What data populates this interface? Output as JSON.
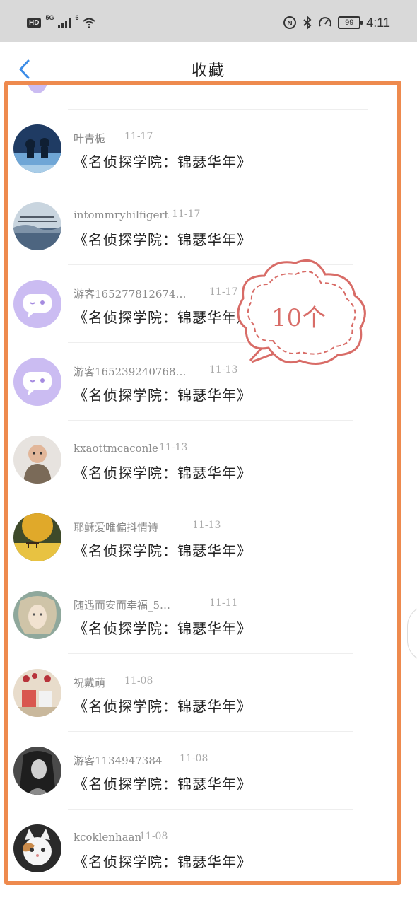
{
  "status_bar": {
    "hd": "HD",
    "network": "5G",
    "wifi_label": "6",
    "battery": "99",
    "time": "4:11",
    "icons": [
      "nfc-icon",
      "bluetooth-icon",
      "speedometer-icon"
    ]
  },
  "nav": {
    "back_icon": "chevron-left-icon",
    "title": "收藏"
  },
  "annotation": {
    "text": "10个",
    "color": "#d86c67",
    "frame_color": "#ee8a4e"
  },
  "items": [
    {
      "name": "叶青栀",
      "date": "11-17",
      "book": "《名侦探学院：锦瑟华年》",
      "avatar": "avatar-kids-silhouette"
    },
    {
      "name": "intommryhilfigert",
      "date": "11-17",
      "book": "《名侦探学院：锦瑟华年》",
      "avatar": "avatar-sea-clouds"
    },
    {
      "name": "游客165277812674…",
      "date": "11-17",
      "book": "《名侦探学院：锦瑟华年》",
      "avatar": "avatar-default-chat"
    },
    {
      "name": "游客165239240768…",
      "date": "11-13",
      "book": "《名侦探学院：锦瑟华年》",
      "avatar": "avatar-default-chat"
    },
    {
      "name": "kxaottmcaconle",
      "date": "11-13",
      "book": "《名侦探学院：锦瑟华年》",
      "avatar": "avatar-baby"
    },
    {
      "name": "耶稣爱唯偏抖情诗",
      "date": "11-13",
      "book": "《名侦探学院：锦瑟华年》",
      "avatar": "avatar-autumn-tree"
    },
    {
      "name": "随遇而安而幸福_5…",
      "date": "11-11",
      "book": "《名侦探学院：锦瑟华年》",
      "avatar": "avatar-doll-face"
    },
    {
      "name": "祝戴萌",
      "date": "11-08",
      "book": "《名侦探学院：锦瑟华年》",
      "avatar": "avatar-cups"
    },
    {
      "name": "游客1134947384",
      "date": "11-08",
      "book": "《名侦探学院：锦瑟华年》",
      "avatar": "avatar-girl-bw"
    },
    {
      "name": "kcoklenhaan",
      "date": "11-08",
      "book": "《名侦探学院：锦瑟华年》",
      "avatar": "avatar-cat"
    }
  ]
}
